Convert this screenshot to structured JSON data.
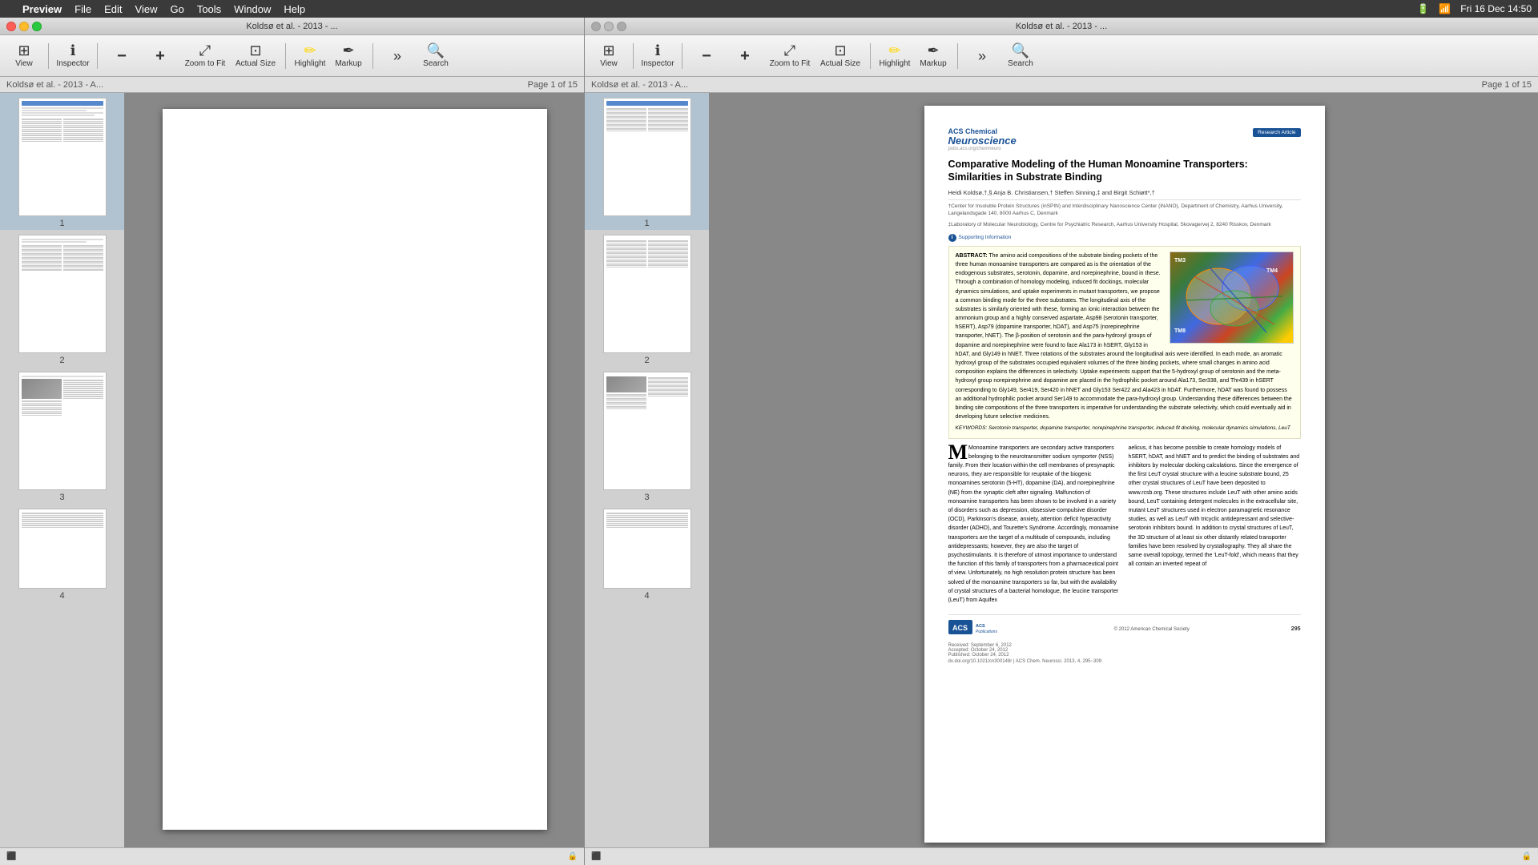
{
  "menubar": {
    "apple": "",
    "items": [
      "Preview",
      "File",
      "Edit",
      "View",
      "Go",
      "Tools",
      "Window",
      "Help"
    ],
    "right": {
      "datetime": "Fri 16 Dec  14:50",
      "battery": "100%",
      "wifi": "WiFi"
    }
  },
  "left_window": {
    "titlebar": {
      "title": "Koldsø et al. - 2013 - ..."
    },
    "page_info": "Page 1 of 15",
    "thumbnail_label": "Koldsø et al. - 2013 - A...",
    "thumbnails": [
      {
        "num": "1",
        "active": true
      },
      {
        "num": "2",
        "active": false
      },
      {
        "num": "3",
        "active": false
      },
      {
        "num": "4",
        "active": false
      }
    ],
    "toolbar": {
      "view_label": "View",
      "inspector_label": "Inspector",
      "zoom_label": "Zoom",
      "zoom_to_fit_label": "Zoom to Fit",
      "actual_size_label": "Actual Size",
      "highlight_label": "Highlight",
      "markup_label": "Markup",
      "search_label": "Search"
    }
  },
  "right_window": {
    "titlebar": {
      "title": "Koldsø et al. - 2013 - ..."
    },
    "page_info": "Page 1 of 15",
    "thumbnail_label": "Koldsø et al. - 2013 - A...",
    "thumbnails": [
      {
        "num": "1",
        "active": true
      },
      {
        "num": "2",
        "active": false
      },
      {
        "num": "3",
        "active": false
      },
      {
        "num": "4",
        "active": false
      }
    ],
    "toolbar": {
      "view_label": "View",
      "inspector_label": "Inspector",
      "zoom_label": "Zoom",
      "zoom_to_fit_label": "Zoom to Fit",
      "actual_size_label": "Actual Size",
      "highlight_label": "Highlight",
      "markup_label": "Markup",
      "search_label": "Search"
    }
  },
  "document": {
    "journal": "ACS Chemical",
    "journal_sub": "Neuroscience",
    "badge": "Research Article",
    "journal_url": "pubs.acs.org/chemneuro",
    "title": "Comparative Modeling of the Human Monoamine Transporters: Similarities in Substrate Binding",
    "authors": "Heidi Koldsø,†,§ Anja B. Christiansen,† Steffen Sinning,‡ and Birgit Schiøtt*,†",
    "affiliation1": "†Center for Insoluble Protein Structures (inSPIN) and Interdisciplinary Nanoscience Center (iNANO), Department of Chemistry, Aarhus University, Langelandsgade 140, 8000 Aarhus C, Denmark",
    "affiliation2": "‡Laboratory of Molecular Neurobiology, Centre for Psychiatric Research, Aarhus University Hospital, Skovagervej 2, 8240 Risskov, Denmark",
    "supporting_info": "Supporting Information",
    "abstract_label": "ABSTRACT:",
    "abstract": "The amino acid compositions of the substrate binding pockets of the three human monoamine transporters are compared as is the orientation of the endogenous substrates, serotonin, dopamine, and norepinephrine, bound in these. Through a combination of homology modeling, induced fit dockings, molecular dynamics simulations, and uptake experiments in mutant transporters, we propose a common binding mode for the three substrates. The longitudinal axis of the substrates is similarly oriented with these, forming an ionic interaction between the ammonium group and a highly conserved aspartate, Asp98 (serotonin transporter, hSERT), Asp79 (dopamine transporter, hDAT), and Asp75 (norepinephrine transporter, hNET). The β-position of serotonin and the para-hydroxyl groups of dopamine and norepinephrine were found to face Ala173 in hSERT, Gly153 in hDAT, and Gly149 in hNET. Three rotations of the substrates around the longitudinal axis were identified. In each mode, an aromatic hydroxyl group of the substrates occupied equivalent volumes of the three binding pockets, where small changes in amino acid composition explains the differences in selectivity. Uptake experiments support that the 5-hydroxyl group of serotonin and the meta-hydroxyl group norepinephrine and dopamine are placed in the hydrophilic pocket around Ala173, Ser338, and Thr439 in hSERT corresponding to Gly149, Ser419, Ser420 in hNET and Gly153 Ser422 and Ala423 in hDAT. Furthermore, hDAT was found to possess an additional hydrophilic pocket around Ser149 to accommodate the para-hydroxyl group. Understanding these differences between the binding site compositions of the three transporters is imperative for understanding the substrate selectivity, which could eventually aid in developing future selective medicines.",
    "keywords": "KEYWORDS: Serotonin transporter, dopamine transporter, norepinephrine transporter, induced fit docking, molecular dynamics simulations, LeuT",
    "body_intro": "Monoamine transporters are secondary active transporters belonging to the neurotransmitter sodium symporter (NSS) family. From their location within the cell membranes of presynaptic neurons, they are responsible for reuptake of the biogenic monoamines serotonin (5-HT), dopamine (DA), and norepinephrine (NE) from the synaptic cleft after signaling. Malfunction of monoamine transporters has been shown to be involved in a variety of disorders such as depression, obsessive-compulsive disorder (OCD), Parkinson's disease, anxiety, attention deficit hyperactivity disorder (ADHD), and Tourette's Syndrome. Accordingly, monoamine transporters are the target of a multitude of compounds, including antidepressants; however, they are also the target of psychostimulants. It is therefore of utmost importance to understand the function of this family of transporters from a pharmaceutical point of view. Unfortunately, no high resolution protein structure has been solved of the monoamine transporters so far, but with the availability of crystal structures of a bacterial homologue, the leucine transporter (LeuT) from Aquifex",
    "body_right": "aelicus, it has become possible to create homology models of hSERT, hDAT, and hNET and to predict the binding of substrates and inhibitors by molecular docking calculations. Since the emergence of the first LeuT crystal structure with a leucine substrate bound, 25 other crystal structures of LeuT have been deposited to www.rcsb.org. These structures include LeuT with other amino acids bound, LeuT containing detergent molecules in the extracellular site, mutant LeuT structures used in electron paramagnetic resonance studies, as well as LeuT with tricyclic antidepressant and selective-serotonin inhibitors bound. In addition to crystal structures of LeuT, the 3D structure of at least six other distantly related transporter families have been resolved by crystallography. They all share the same overall topology, termed the 'LeuT-fold', which means that they all contain an inverted repeat of",
    "page_number": "295",
    "received": "September 6, 2012",
    "accepted": "October 24, 2012",
    "published": "October 24, 2012"
  }
}
